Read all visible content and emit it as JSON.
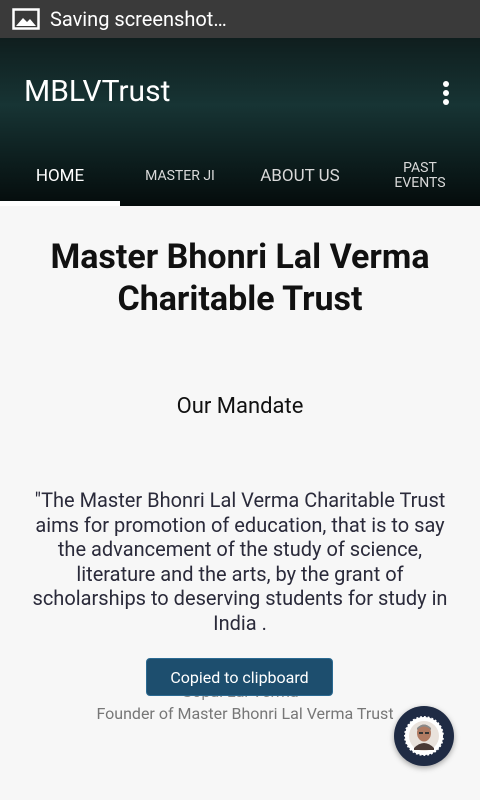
{
  "status_bar": {
    "icon": "image-icon",
    "text": "Saving screenshot…"
  },
  "app_bar": {
    "title": "MBLVTrust",
    "menu_icon": "overflow-menu-icon"
  },
  "tabs": [
    {
      "label": "HOME",
      "active": true
    },
    {
      "label": "MASTER JI",
      "active": false
    },
    {
      "label": "ABOUT US",
      "active": false
    },
    {
      "label": "PAST\nEVENTS",
      "active": false
    }
  ],
  "content": {
    "title": "Master Bhonri Lal Verma Charitable Trust",
    "subtitle": "Our Mandate",
    "mandate": "\"The Master Bhonri Lal Verma Charitable Trust aims for promotion of education, that is to say the  advancement of the study of science, literature and the arts, by the grant of scholarships to  deserving students for study in India .",
    "founder_name": "Gopal Lal Verma",
    "founder_role": "Founder of Master Bhonri Lal Verma Trust"
  },
  "toast": {
    "text": "Copied to clipboard"
  },
  "fab": {
    "icon": "portrait-icon"
  },
  "colors": {
    "status_bar": "#3a3a3a",
    "toast": "#1d4e6e",
    "fab": "#1f2b44"
  }
}
